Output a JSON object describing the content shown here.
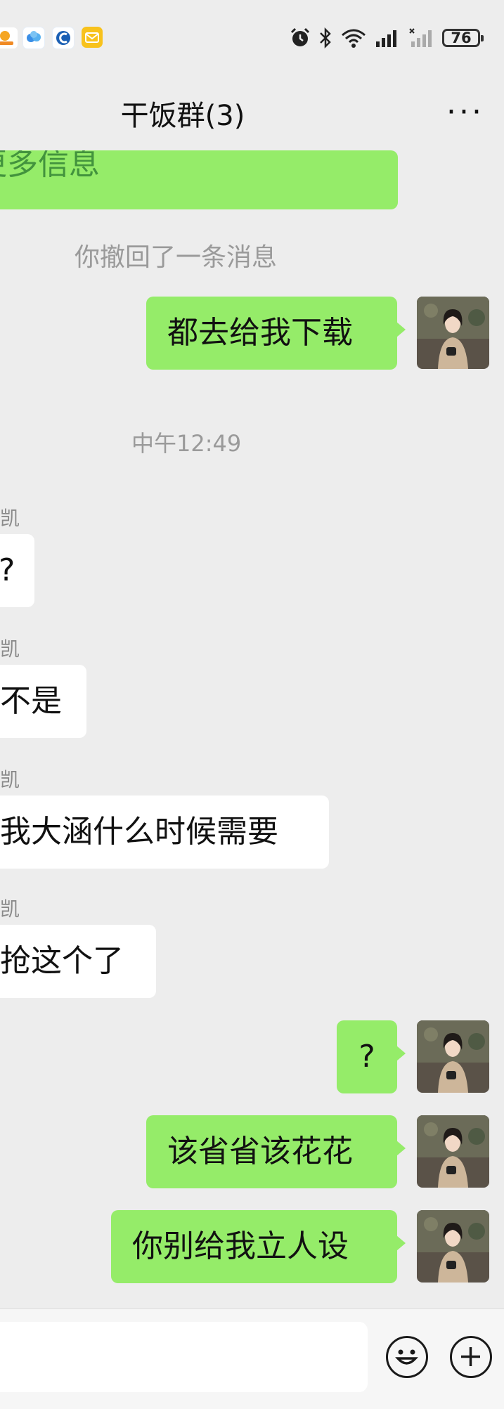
{
  "status_bar": {
    "apps": [
      {
        "icon": "orange-app-icon",
        "color": "#f5a623"
      },
      {
        "icon": "cloud-app-icon",
        "color": "#3a8ee6"
      },
      {
        "icon": "blue-c-app-icon",
        "color": "#1a5fb4"
      },
      {
        "icon": "mail-app-icon",
        "color": "#f8c21c"
      }
    ],
    "battery": "76"
  },
  "header": {
    "title": "干饭群(3)",
    "more_label": "···"
  },
  "messages": [
    {
      "kind": "out",
      "text": "更多信息",
      "partial": true
    },
    {
      "kind": "system",
      "text": "你撤回了一条消息"
    },
    {
      "kind": "out",
      "text": "都去给我下载"
    },
    {
      "kind": "time",
      "text": "中午12:49"
    },
    {
      "kind": "in",
      "sender": "凯",
      "text": "?"
    },
    {
      "kind": "in",
      "sender": "凯",
      "text": "不是"
    },
    {
      "kind": "in",
      "sender": "凯",
      "text": "我大涵什么时候需要"
    },
    {
      "kind": "in",
      "sender": "凯",
      "text": "抢这个了"
    },
    {
      "kind": "out",
      "text": "?"
    },
    {
      "kind": "out",
      "text": "该省省该花花"
    },
    {
      "kind": "out",
      "text": "你别给我立人设"
    }
  ],
  "colors": {
    "background": "#ededed",
    "mine_bubble": "#95ec69",
    "theirs_bubble": "#ffffff",
    "muted_text": "#9a9a9a"
  },
  "input_bar": {
    "emoji_icon": "smiley-icon",
    "plus_icon": "plus-icon"
  }
}
